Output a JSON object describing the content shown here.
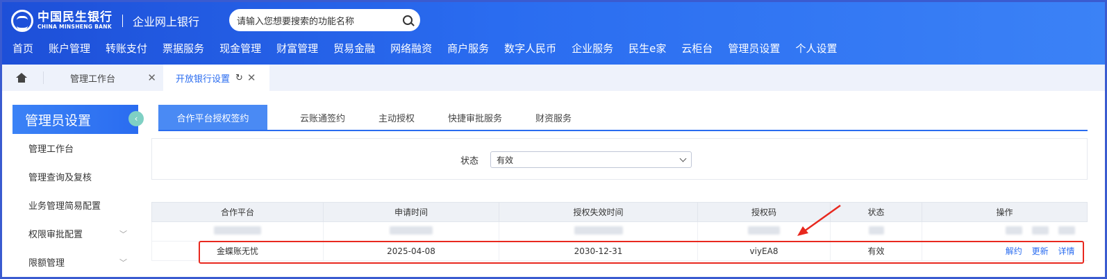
{
  "header": {
    "logo_cn": "中国民生银行",
    "logo_en": "CHINA MINSHENG BANK",
    "subtitle": "企业网上银行",
    "search_placeholder": "请输入您想要搜索的功能名称",
    "nav": [
      "首页",
      "账户管理",
      "转账支付",
      "票据服务",
      "现金管理",
      "财富管理",
      "贸易金融",
      "网络融资",
      "商户服务",
      "数字人民币",
      "企业服务",
      "民生e家",
      "云柜台",
      "管理员设置",
      "个人设置"
    ]
  },
  "tabs": {
    "home_icon": "home-icon",
    "items": [
      {
        "label": "管理工作台",
        "active": false
      },
      {
        "label": "开放银行设置",
        "active": true
      }
    ]
  },
  "sidebar": {
    "title": "管理员设置",
    "items": [
      {
        "label": "管理工作台",
        "expandable": false
      },
      {
        "label": "管理查询及复核",
        "expandable": false
      },
      {
        "label": "业务管理简易配置",
        "expandable": false
      },
      {
        "label": "权限审批配置",
        "expandable": true
      },
      {
        "label": "限额管理",
        "expandable": true
      }
    ]
  },
  "subtabs": [
    "合作平台授权签约",
    "云账通签约",
    "主动授权",
    "快捷审批服务",
    "财资服务"
  ],
  "filter": {
    "label": "状态",
    "value": "有效"
  },
  "table": {
    "headers": [
      "合作平台",
      "申请时间",
      "授权失效时间",
      "授权码",
      "状态",
      "操作"
    ],
    "rows": [
      {
        "platform": "金蝶账无忧",
        "apply_date": "2025-04-08",
        "expire_date": "2030-12-31",
        "auth_code": "viyEA8",
        "status": "有效",
        "actions": [
          "解约",
          "更新",
          "详情"
        ]
      }
    ]
  },
  "colors": {
    "primary": "#2a6cf0",
    "highlight": "#e8281e"
  }
}
